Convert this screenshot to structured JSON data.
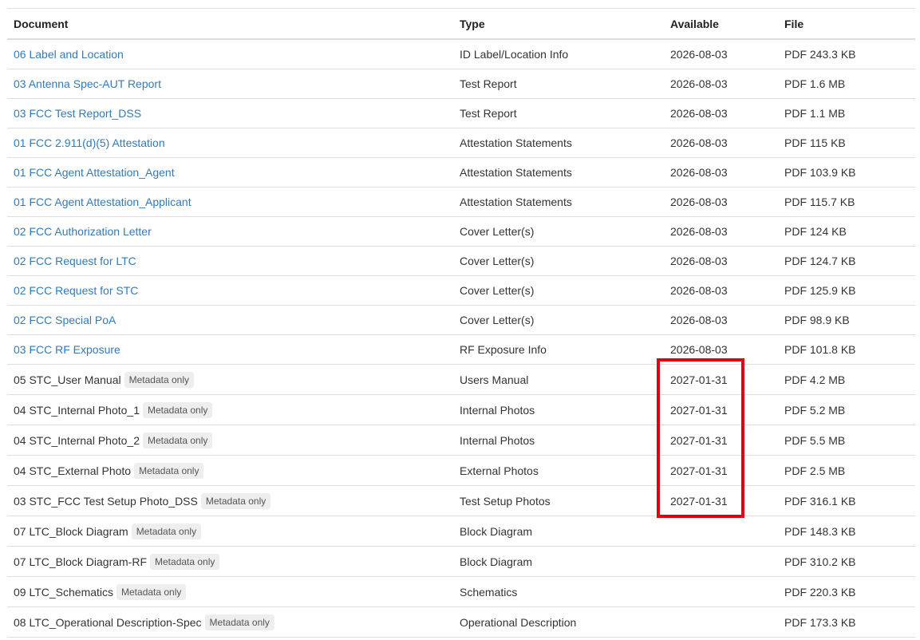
{
  "headers": {
    "document": "Document",
    "type": "Type",
    "available": "Available",
    "file": "File"
  },
  "badge_label": "Metadata only",
  "colors": {
    "link": "#337ab7",
    "highlight_box": "#e00010",
    "badge_bg": "#eeeeee",
    "border": "#dddddd"
  },
  "rows": [
    {
      "document": "06 Label and Location",
      "type": "ID Label/Location Info",
      "available": "2026-08-03",
      "file": "PDF 243.3 KB",
      "link": true,
      "metadata_only": false
    },
    {
      "document": "03 Antenna Spec-AUT Report",
      "type": "Test Report",
      "available": "2026-08-03",
      "file": "PDF 1.6 MB",
      "link": true,
      "metadata_only": false
    },
    {
      "document": "03 FCC Test Report_DSS",
      "type": "Test Report",
      "available": "2026-08-03",
      "file": "PDF 1.1 MB",
      "link": true,
      "metadata_only": false
    },
    {
      "document": "01 FCC 2.911(d)(5) Attestation",
      "type": "Attestation Statements",
      "available": "2026-08-03",
      "file": "PDF 115 KB",
      "link": true,
      "metadata_only": false
    },
    {
      "document": "01 FCC Agent Attestation_Agent",
      "type": "Attestation Statements",
      "available": "2026-08-03",
      "file": "PDF 103.9 KB",
      "link": true,
      "metadata_only": false
    },
    {
      "document": "01 FCC Agent Attestation_Applicant",
      "type": "Attestation Statements",
      "available": "2026-08-03",
      "file": "PDF 115.7 KB",
      "link": true,
      "metadata_only": false
    },
    {
      "document": "02 FCC Authorization Letter",
      "type": "Cover Letter(s)",
      "available": "2026-08-03",
      "file": "PDF 124 KB",
      "link": true,
      "metadata_only": false
    },
    {
      "document": "02 FCC Request for LTC",
      "type": "Cover Letter(s)",
      "available": "2026-08-03",
      "file": "PDF 124.7 KB",
      "link": true,
      "metadata_only": false
    },
    {
      "document": "02 FCC Request for STC",
      "type": "Cover Letter(s)",
      "available": "2026-08-03",
      "file": "PDF 125.9 KB",
      "link": true,
      "metadata_only": false
    },
    {
      "document": "02 FCC Special PoA",
      "type": "Cover Letter(s)",
      "available": "2026-08-03",
      "file": "PDF 98.9 KB",
      "link": true,
      "metadata_only": false
    },
    {
      "document": "03 FCC RF Exposure",
      "type": "RF Exposure Info",
      "available": "2026-08-03",
      "file": "PDF 101.8 KB",
      "link": true,
      "metadata_only": false
    },
    {
      "document": "05 STC_User Manual",
      "type": "Users Manual",
      "available": "2027-01-31",
      "file": "PDF 4.2 MB",
      "link": false,
      "metadata_only": true
    },
    {
      "document": "04 STC_Internal Photo_1",
      "type": "Internal Photos",
      "available": "2027-01-31",
      "file": "PDF 5.2 MB",
      "link": false,
      "metadata_only": true
    },
    {
      "document": "04 STC_Internal Photo_2",
      "type": "Internal Photos",
      "available": "2027-01-31",
      "file": "PDF 5.5 MB",
      "link": false,
      "metadata_only": true
    },
    {
      "document": "04 STC_External Photo",
      "type": "External Photos",
      "available": "2027-01-31",
      "file": "PDF 2.5 MB",
      "link": false,
      "metadata_only": true
    },
    {
      "document": "03 STC_FCC Test Setup Photo_DSS",
      "type": "Test Setup Photos",
      "available": "2027-01-31",
      "file": "PDF 316.1 KB",
      "link": false,
      "metadata_only": true
    },
    {
      "document": "07 LTC_Block Diagram",
      "type": "Block Diagram",
      "available": "",
      "file": "PDF 148.3 KB",
      "link": false,
      "metadata_only": true
    },
    {
      "document": "07 LTC_Block Diagram-RF",
      "type": "Block Diagram",
      "available": "",
      "file": "PDF 310.2 KB",
      "link": false,
      "metadata_only": true
    },
    {
      "document": "09 LTC_Schematics",
      "type": "Schematics",
      "available": "",
      "file": "PDF 220.3 KB",
      "link": false,
      "metadata_only": true
    },
    {
      "document": "08 LTC_Operational Description-Spec",
      "type": "Operational Description",
      "available": "",
      "file": "PDF 173.3 KB",
      "link": false,
      "metadata_only": true
    }
  ]
}
